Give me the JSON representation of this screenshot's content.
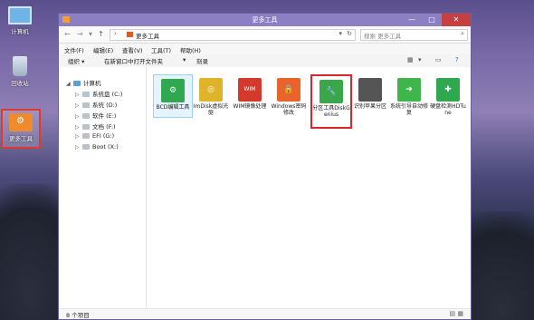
{
  "desktop": {
    "icons": [
      {
        "label": "计算机"
      },
      {
        "label": "回收站"
      },
      {
        "label": "更多工具"
      }
    ]
  },
  "window": {
    "title": "更多工具",
    "controls": {
      "minimize": "—",
      "maximize": "□",
      "close": "✕"
    },
    "address": {
      "breadcrumb": "更多工具",
      "search_placeholder": "搜索 更多工具"
    },
    "menu": [
      "文件(F)",
      "编辑(E)",
      "查看(V)",
      "工具(T)",
      "帮助(H)"
    ],
    "toolbar": {
      "organize": "组织 ▾",
      "open_in_window": "在新窗口中打开文件夹",
      "burn": "刻录"
    },
    "tree": [
      {
        "label": "计算机",
        "type": "pc"
      },
      {
        "label": "系统盘 (C:)",
        "type": "drive"
      },
      {
        "label": "系统 (D:)",
        "type": "drive"
      },
      {
        "label": "软件 (E:)",
        "type": "drive"
      },
      {
        "label": "文档 (F:)",
        "type": "drive"
      },
      {
        "label": "EFI (G:)",
        "type": "drive"
      },
      {
        "label": "Boot (X:)",
        "type": "drive"
      }
    ],
    "items": [
      {
        "label": "BCD编辑工具",
        "color": "#2fa84f",
        "glyph": "⚙"
      },
      {
        "label": "ImDisk虚拟光驱",
        "color": "#e0b42a",
        "glyph": "◎"
      },
      {
        "label": "WIM镜像处理",
        "color": "#d33a2c",
        "glyph": "WIM"
      },
      {
        "label": "Windows密码修改",
        "color": "#e8642a",
        "glyph": "🔒"
      },
      {
        "label": "分区工具DiskGenius",
        "color": "#3aa84a",
        "glyph": "🔧"
      },
      {
        "label": "识别苹果分区",
        "color": "#555555",
        "glyph": ""
      },
      {
        "label": "系统引导自动修复",
        "color": "#3fb54c",
        "glyph": "➜"
      },
      {
        "label": "硬盘检测HDTune",
        "color": "#2fa84f",
        "glyph": "✚"
      }
    ],
    "status": "8 个项目"
  }
}
